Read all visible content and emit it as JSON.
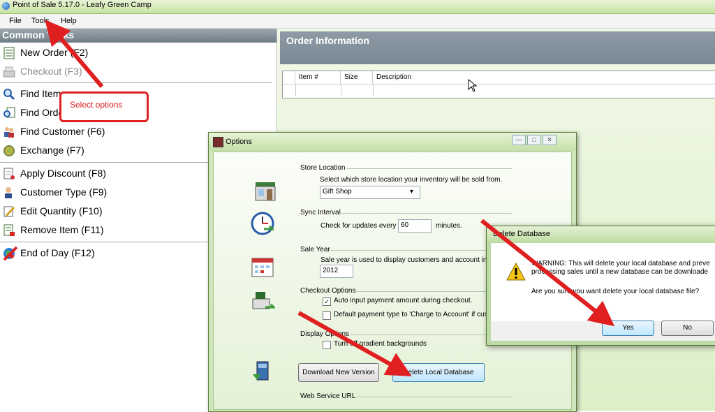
{
  "window": {
    "title": "Point of Sale 5.17.0 - Leafy Green Camp"
  },
  "menu": [
    "File",
    "Tools",
    "Help"
  ],
  "left_panel": {
    "header": "Common Tasks",
    "tasks": [
      {
        "label": "New Order (F2)",
        "icon": "new-order-icon",
        "enabled": true
      },
      {
        "label": "Checkout (F3)",
        "icon": "checkout-icon",
        "enabled": false
      },
      {
        "label": "Find Item",
        "icon": "find-item-icon",
        "enabled": true
      },
      {
        "label": "Find Order",
        "icon": "find-order-icon",
        "enabled": true
      },
      {
        "label": "Find Customer (F6)",
        "icon": "find-customer-icon",
        "enabled": true
      },
      {
        "label": "Exchange (F7)",
        "icon": "exchange-icon",
        "enabled": true
      },
      {
        "label": "Apply Discount (F8)",
        "icon": "apply-discount-icon",
        "enabled": true
      },
      {
        "label": "Customer Type (F9)",
        "icon": "customer-type-icon",
        "enabled": true
      },
      {
        "label": "Edit Quantity (F10)",
        "icon": "edit-quantity-icon",
        "enabled": true
      },
      {
        "label": "Remove Item (F11)",
        "icon": "remove-item-icon",
        "enabled": true
      },
      {
        "label": "End of Day (F12)",
        "icon": "end-of-day-icon",
        "enabled": true
      }
    ]
  },
  "order_panel": {
    "title": "Order Information",
    "columns": [
      "Item #",
      "Size",
      "Description"
    ]
  },
  "options_dialog": {
    "title": "Options",
    "store_location": {
      "title": "Store Location",
      "description": "Select which store location your inventory will be sold from.",
      "selected": "Gift Shop"
    },
    "sync_interval": {
      "title": "Sync Interval",
      "prefix": "Check for updates every",
      "value": "60",
      "suffix": "minutes."
    },
    "sale_year": {
      "title": "Sale Year",
      "description": "Sale year is used to display customers and account infom",
      "value": "2012"
    },
    "checkout_options": {
      "title": "Checkout Options",
      "option1": "Auto input payment amount during checkout.",
      "option1_checked": true,
      "option2": "Default payment type to 'Charge to Account' if custom",
      "option2_checked": false
    },
    "display_options": {
      "title": "Display Options",
      "option1": "Turn off gradient backgrounds",
      "option1_checked": false
    },
    "buttons": {
      "download": "Download New Version",
      "delete": "Delete Local Database"
    },
    "web_service_url": {
      "title": "Web Service URL"
    }
  },
  "delete_dialog": {
    "title": "Delete Database",
    "warning_line1": "WARNING: This will delete your local database and preve",
    "warning_line2": "processing sales until a new database can be downloade",
    "question": "Are you sure you want delete your local database file?",
    "yes": "Yes",
    "no": "No"
  },
  "annotation": {
    "callout": "Select options"
  },
  "colors": {
    "annotation_red": "#e02020"
  }
}
